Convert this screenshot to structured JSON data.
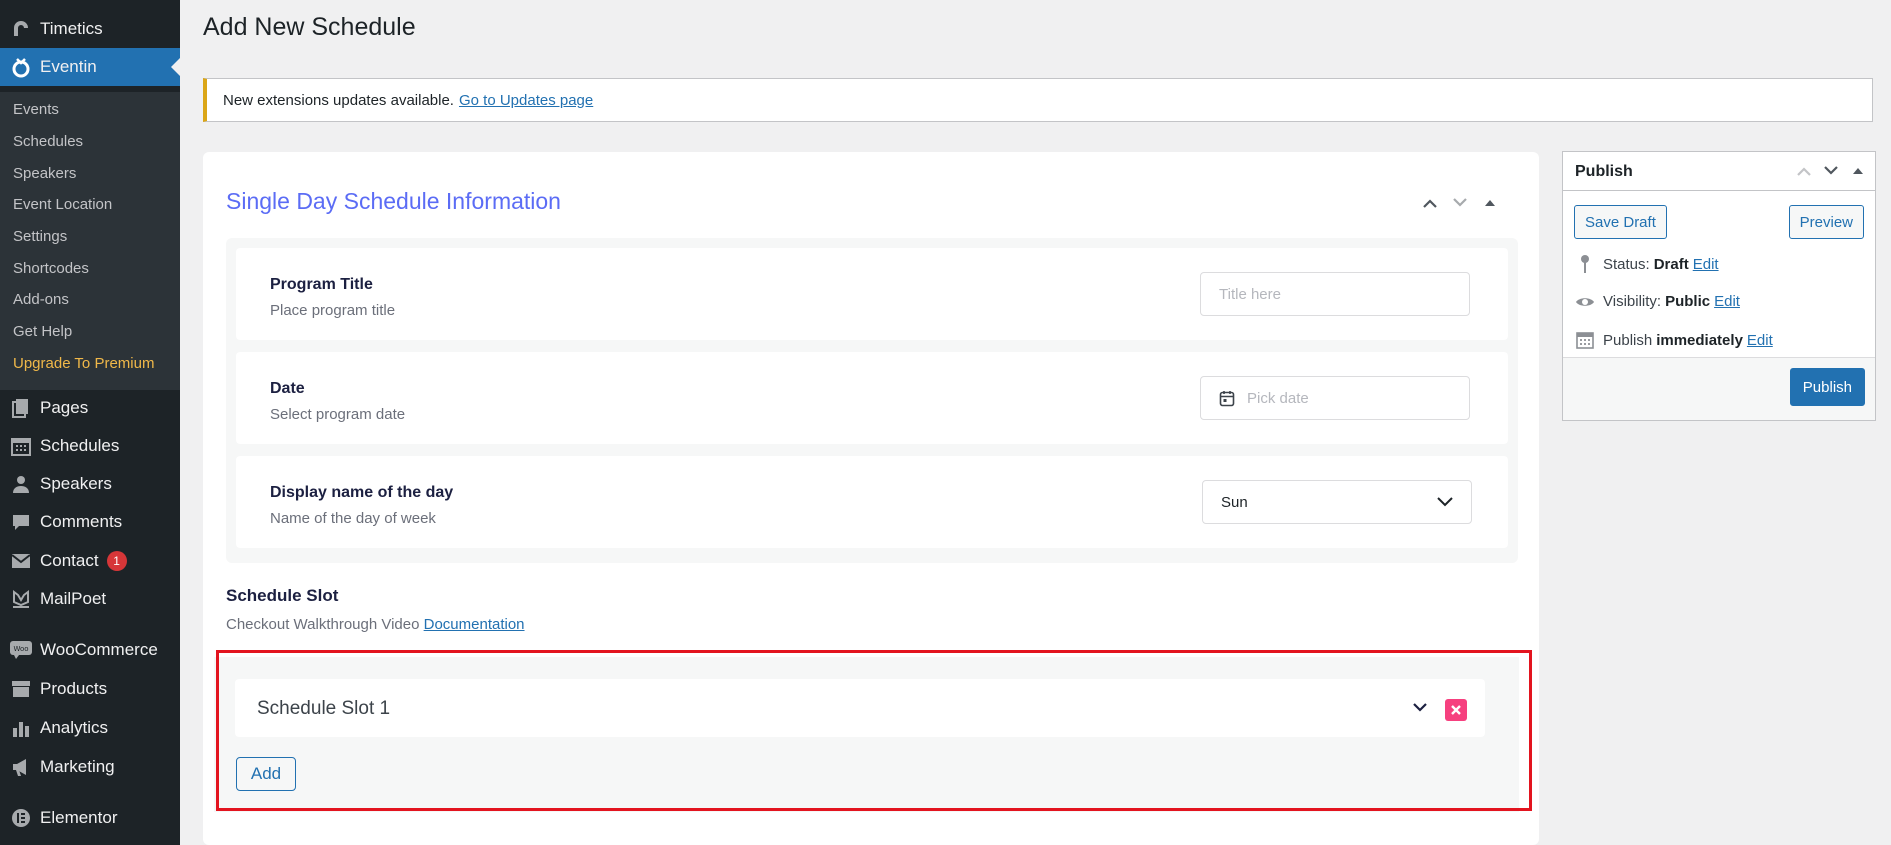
{
  "sidebar": {
    "top_items": [
      {
        "label": "Timetics",
        "icon": "timetics-icon"
      },
      {
        "label": "Eventin",
        "icon": "eventin-icon"
      }
    ],
    "submenu": [
      "Events",
      "Schedules",
      "Speakers",
      "Event Location",
      "Settings",
      "Shortcodes",
      "Add-ons",
      "Get Help",
      "Upgrade To Premium"
    ],
    "items": [
      {
        "label": "Pages",
        "icon": "pages-icon"
      },
      {
        "label": "Schedules",
        "icon": "calendar-icon"
      },
      {
        "label": "Speakers",
        "icon": "user-icon"
      },
      {
        "label": "Comments",
        "icon": "comment-icon"
      },
      {
        "label": "Contact",
        "icon": "mail-icon",
        "badge": "1"
      },
      {
        "label": "MailPoet",
        "icon": "mailpoet-icon"
      },
      {
        "label": "WooCommerce",
        "icon": "woo-icon"
      },
      {
        "label": "Products",
        "icon": "archive-icon"
      },
      {
        "label": "Analytics",
        "icon": "bar-chart-icon"
      },
      {
        "label": "Marketing",
        "icon": "megaphone-icon"
      },
      {
        "label": "Elementor",
        "icon": "elementor-icon"
      }
    ]
  },
  "page": {
    "title": "Add New Schedule"
  },
  "notice": {
    "text": "New extensions updates available.",
    "link": "Go to Updates page"
  },
  "metabox": {
    "title": "Single Day Schedule Information",
    "fields": [
      {
        "label": "Program Title",
        "description": "Place program title",
        "placeholder": "Title here"
      },
      {
        "label": "Date",
        "description": "Select program date",
        "placeholder": "Pick date"
      },
      {
        "label": "Display name of the day",
        "description": "Name of the day of week",
        "value": "Sun"
      }
    ],
    "schedule_slot": {
      "heading": "Schedule Slot",
      "description": "Checkout Walkthrough Video",
      "doc_link": "Documentation",
      "slots": [
        {
          "title": "Schedule Slot 1"
        }
      ],
      "add_label": "Add"
    }
  },
  "publish": {
    "title": "Publish",
    "save_draft": "Save Draft",
    "preview": "Preview",
    "status_label": "Status:",
    "status_value": "Draft",
    "visibility_label": "Visibility:",
    "visibility_value": "Public",
    "publish_label": "Publish",
    "publish_value": "immediately",
    "edit": "Edit",
    "publish_button": "Publish"
  },
  "colors": {
    "sidebar_bg": "#1d2327",
    "accent": "#2271b1",
    "highlight_outline": "#e3141f",
    "remove_button": "#f6407f",
    "metabox_title": "#5b6cf5",
    "premium": "#f0b849"
  }
}
